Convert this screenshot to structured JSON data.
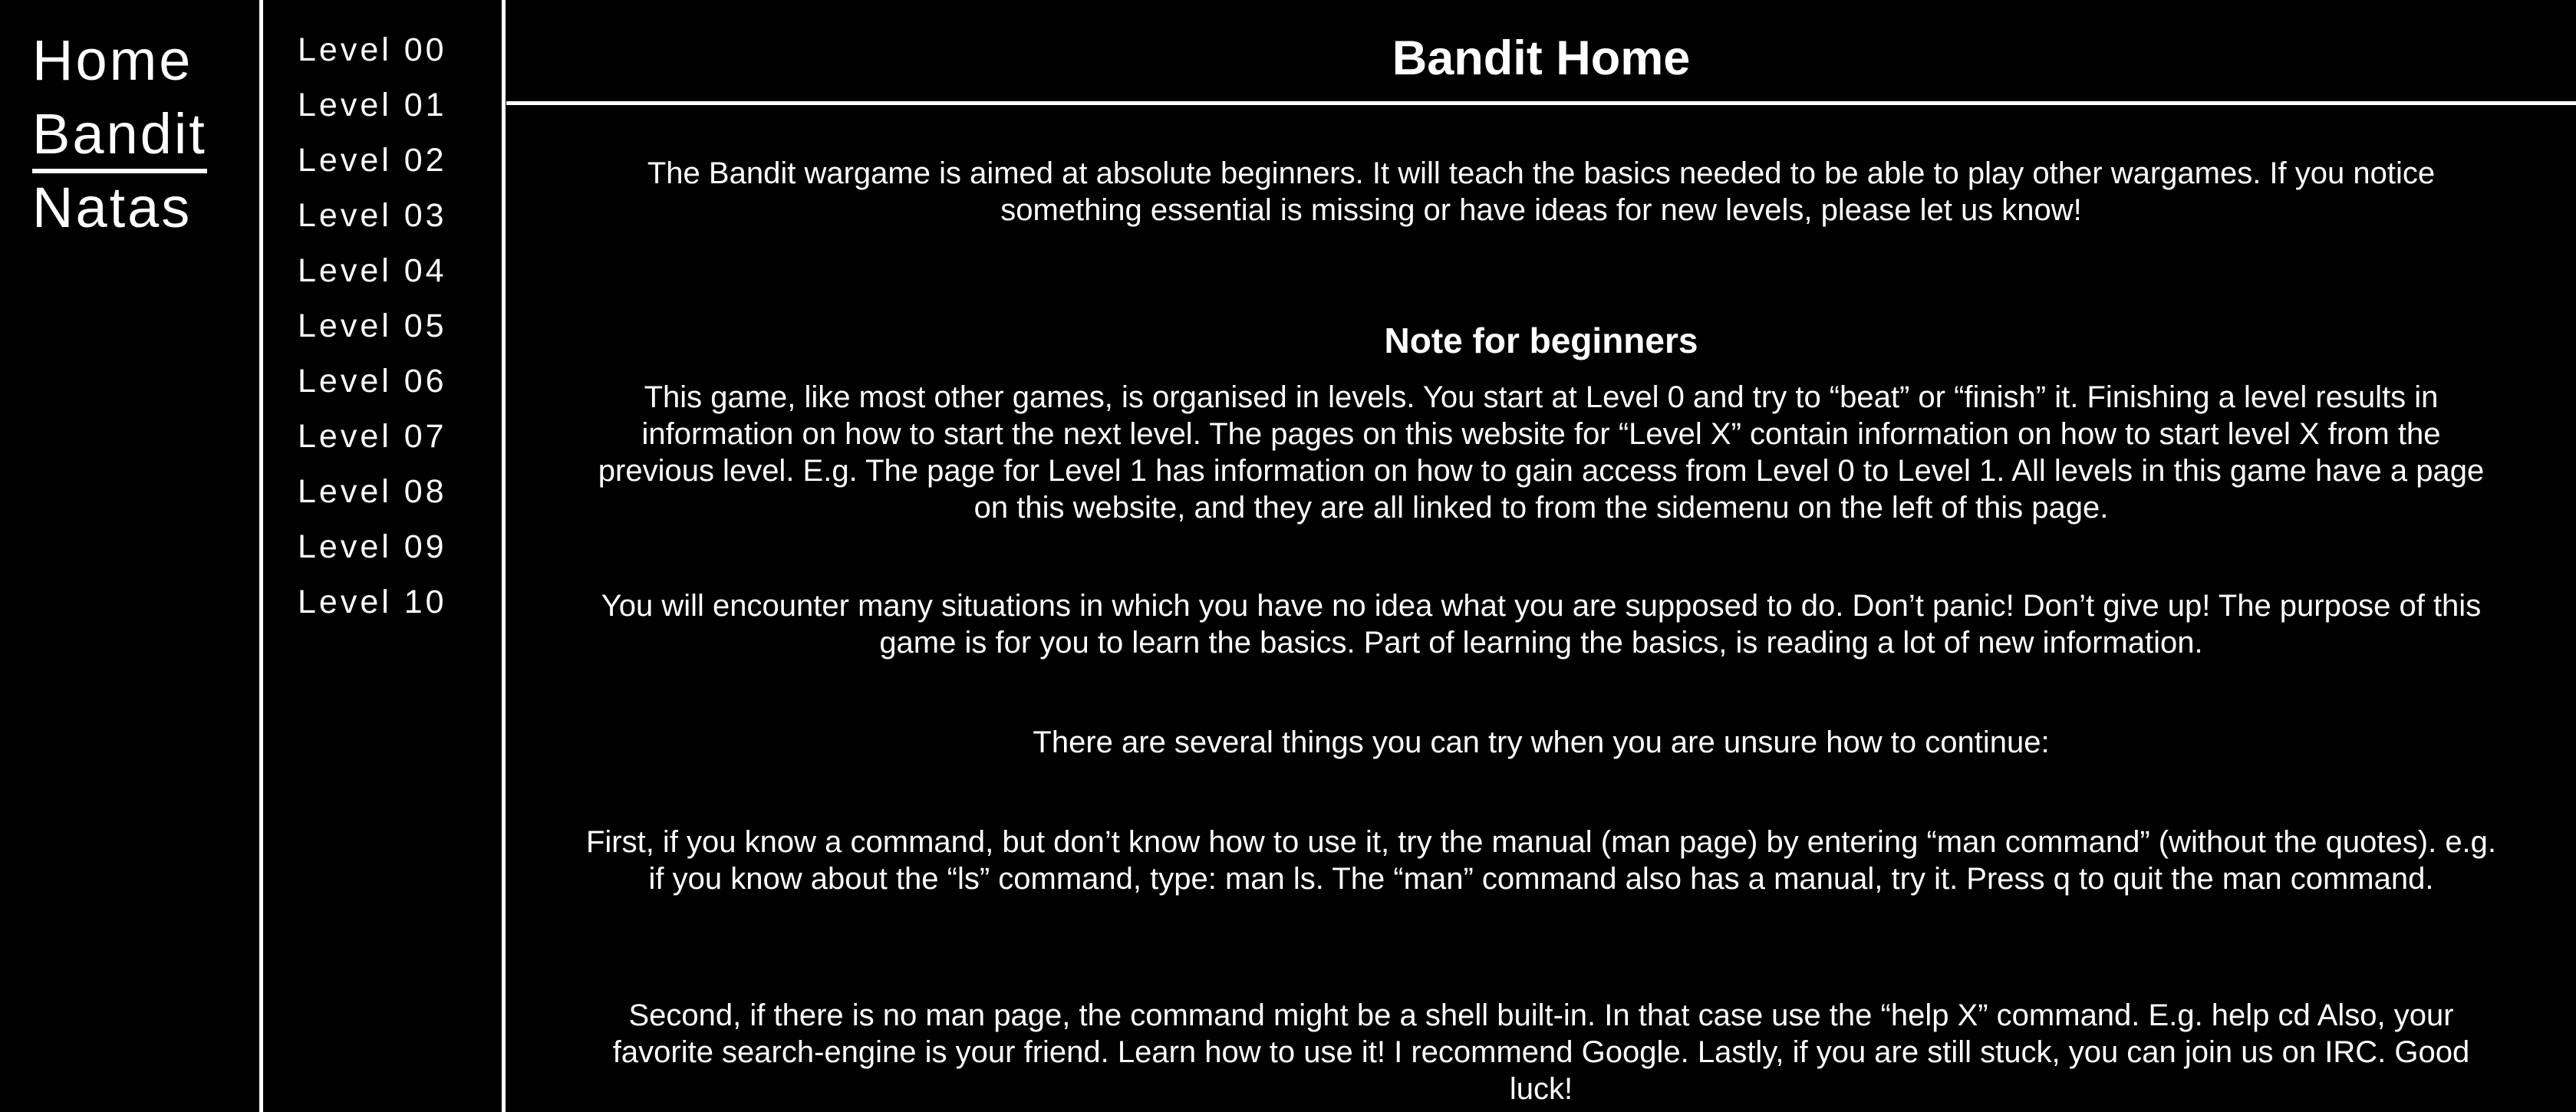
{
  "nav": {
    "items": [
      {
        "label": "Home"
      },
      {
        "label": "Bandit"
      },
      {
        "label": "Natas"
      }
    ]
  },
  "levels": {
    "items": [
      "Level 00",
      "Level 01",
      "Level 02",
      "Level 03",
      "Level 04",
      "Level 05",
      "Level 06",
      "Level 07",
      "Level 08",
      "Level 09",
      "Level 10"
    ]
  },
  "main": {
    "title": "Bandit Home",
    "intro": "The Bandit wargame is aimed at absolute beginners. It will teach the basics needed to be able to play other wargames. If you notice something essential is missing or have ideas for new levels, please let us know!",
    "note_heading": "Note for beginners",
    "paragraphs": [
      "This game, like most other games, is organised in levels. You start at Level 0 and try to “beat” or “finish” it. Finishing a level results in information on how to start the next level. The pages on this website for “Level X” contain information on how to start level X from the previous level. E.g. The page for Level 1 has information on how to gain access from Level 0 to Level 1. All levels in this game have a page on this website, and they are all linked to from the sidemenu on the left of this page.",
      "You will encounter many situations in which you have no idea what you are supposed to do. Don’t panic! Don’t give up! The purpose of this game is for you to learn the basics. Part of learning the basics, is reading a lot of new information.",
      "There are several things you can try when you are unsure how to continue:",
      "First, if you know a command, but don’t know how to use it, try the manual (man page) by entering “man command” (without the quotes). e.g. if you know about the “ls” command, type: man ls. The “man” command also has a manual, try it. Press q to quit the man command.",
      "Second, if there is no man page, the command might be a shell built-in. In that case use the “help X” command. E.g. help cd Also, your favorite search-engine is your friend. Learn how to use it! I recommend Google. Lastly, if you are still stuck, you can join us on IRC. Good luck!"
    ]
  },
  "colors": {
    "background": "#000000",
    "text": "#ffffff"
  }
}
